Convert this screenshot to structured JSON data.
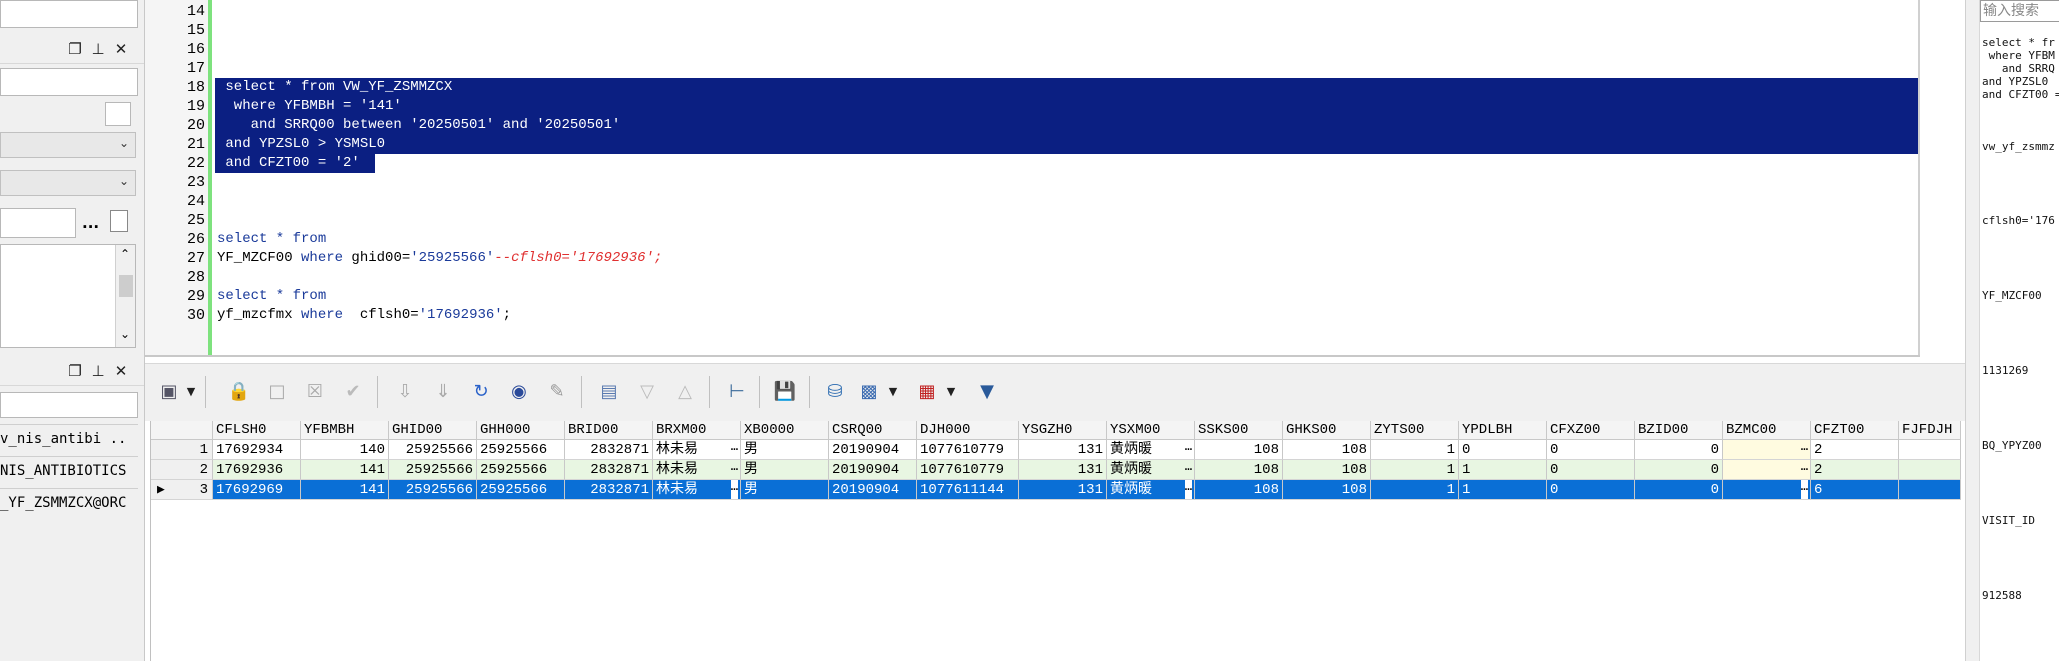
{
  "left_panel": {
    "dock_icons": {
      "restore": "❐",
      "pin": "⊥",
      "close": "✕"
    },
    "browse_button": "...",
    "objects": [
      "v_nis_antibi ..",
      "NIS_ANTIBIOTICS",
      "_YF_ZSMMZCX@ORC"
    ]
  },
  "editor": {
    "lines": [
      {
        "n": "14",
        "text": ""
      },
      {
        "n": "15",
        "text": ""
      },
      {
        "n": "16",
        "text": ""
      },
      {
        "n": "17",
        "text": ""
      },
      {
        "n": "18",
        "text": " select * from VW_YF_ZSMMZCX"
      },
      {
        "n": "19",
        "text": "  where YFBMBH = '141'"
      },
      {
        "n": "20",
        "text": "    and SRRQ00 between '20250501' and '20250501'"
      },
      {
        "n": "21",
        "text": " and YPZSL0 > YSMSL0"
      },
      {
        "n": "22",
        "text": " and CFZT00 = '2'"
      },
      {
        "n": "23",
        "text": ""
      },
      {
        "n": "24",
        "text": ""
      },
      {
        "n": "25",
        "text": ""
      },
      {
        "n": "26",
        "text": ""
      },
      {
        "n": "27",
        "text": ""
      },
      {
        "n": "28",
        "text": ""
      },
      {
        "n": "29",
        "text": ""
      },
      {
        "n": "30",
        "text": ""
      }
    ],
    "l26_kw": "select * from",
    "l27_a": "YF_MZCF00 ",
    "l27_kw": "where",
    "l27_b": " ghid00=",
    "l27_str": "'25925566'",
    "l27_cmt": "--cflsh0='17692936';",
    "l29_kw": "select * from",
    "l30_a": "yf_mzcfmx ",
    "l30_kw": "where",
    "l30_b": "  cflsh0=",
    "l30_str": "'17692936'",
    "l30_c": ";"
  },
  "toolbar": {
    "icons": [
      "select-icon",
      "lock-icon",
      "insert-icon",
      "delete-icon",
      "post-icon",
      "filter-down-icon",
      "filter-all-icon",
      "refresh-icon",
      "find-icon",
      "clear-icon",
      "report-icon",
      "sort-desc-icon",
      "sort-asc-icon",
      "tree-icon",
      "save-icon",
      "db-icon",
      "chart-icon",
      "grid-icon",
      "funnel-icon"
    ]
  },
  "grid": {
    "columns": [
      "CFLSH0",
      "YFBMBH",
      "GHID00",
      "GHH000",
      "BRID00",
      "BRXM00",
      "XB0000",
      "CSRQ00",
      "DJH000",
      "YSGZH0",
      "YSXM00",
      "SSKS00",
      "GHKS00",
      "ZYTS00",
      "YPDLBH",
      "CFXZ00",
      "BZID00",
      "BZMC00",
      "CFZT00",
      "FJFDJH"
    ],
    "rows": [
      {
        "idx": "1",
        "cells": [
          "17692934",
          "140",
          "25925566",
          "25925566",
          "2832871",
          "林未易",
          "男",
          "20190904",
          "1077610779",
          "131",
          "黄炳暖",
          "108",
          "108",
          "1",
          "0",
          "0",
          "0",
          "",
          "2",
          ""
        ]
      },
      {
        "idx": "2",
        "cells": [
          "17692936",
          "141",
          "25925566",
          "25925566",
          "2832871",
          "林未易",
          "男",
          "20190904",
          "1077610779",
          "131",
          "黄炳暖",
          "108",
          "108",
          "1",
          "1",
          "0",
          "0",
          "",
          "2",
          ""
        ]
      },
      {
        "idx": "3",
        "cells": [
          "17692969",
          "141",
          "25925566",
          "25925566",
          "2832871",
          "林未易",
          "男",
          "20190904",
          "1077611144",
          "131",
          "黄炳暖",
          "108",
          "108",
          "1",
          "1",
          "0",
          "0",
          "",
          "6",
          ""
        ]
      }
    ],
    "current_row_marker": "▶"
  },
  "right_panel": {
    "search_placeholder": "输入搜索",
    "snippet": "select * fr\n where YFBM\n   and SRRQ\nand YPZSL0\nand CFZT00 =",
    "items": [
      "vw_yf_zsmmz",
      "cflsh0='176",
      "YF_MZCF00",
      "1131269",
      "BQ_YPYZ00",
      "VISIT_ID",
      "912588"
    ]
  }
}
